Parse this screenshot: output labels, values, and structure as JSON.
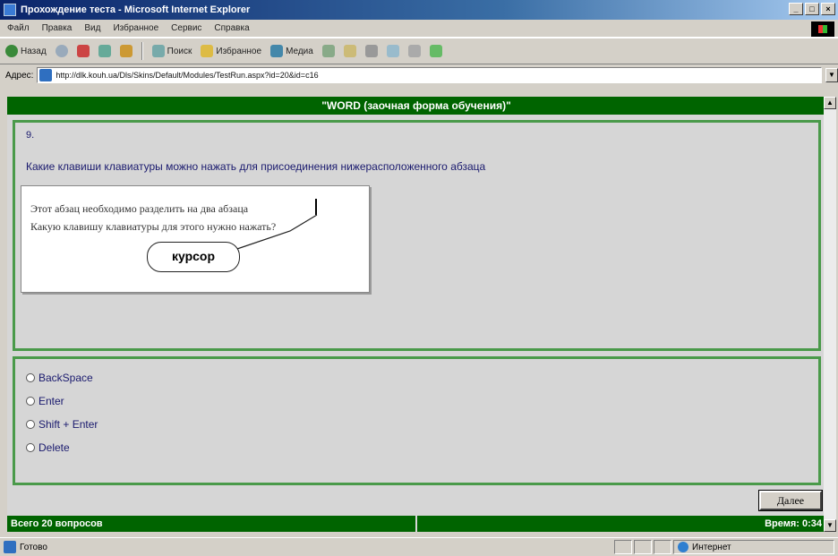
{
  "window": {
    "title": "Прохождение теста - Microsoft Internet Explorer",
    "buttons": [
      "_",
      "□",
      "×"
    ]
  },
  "menu": [
    "Файл",
    "Правка",
    "Вид",
    "Избранное",
    "Сервис",
    "Справка"
  ],
  "toolbar": {
    "back": "Назад",
    "search": "Поиск",
    "favorites": "Избранное",
    "media": "Медиа"
  },
  "address": {
    "label": "Адрес:",
    "url": "http://dlk.kouh.ua/Dls/Skins/Default/Modules/TestRun.aspx?id=20&id=c16"
  },
  "test": {
    "header": "\"WORD (заочная форма обучения)\"",
    "question_number": "9.",
    "question_text": "Какие клавиши клавиатуры можно нажать для присоединения нижерасположенного абзаца",
    "illustration": {
      "line1": "Этот абзац необходимо разделить на два абзаца",
      "line2": "Какую клавишу клавиатуры для этого нужно нажать?",
      "callout": "курсор"
    },
    "answers": [
      "BackSpace",
      "Enter",
      "Shift + Enter",
      "Delete"
    ],
    "next_label": "Далее",
    "total_questions": "Всего 20 вопросов",
    "time": "Время: 0:34"
  },
  "status": {
    "text": "Готово",
    "zone": "Интернет"
  },
  "colors": {
    "header_green": "#006400",
    "panel_border": "#4a9a4a",
    "text_blue": "#1a1a6e"
  }
}
